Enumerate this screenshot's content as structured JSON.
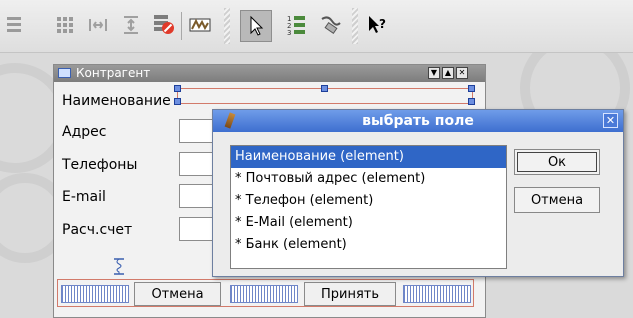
{
  "toolbar": {
    "icons": [
      "distribute-vertical-icon",
      "grid-layout-icon",
      "break-layout-icon",
      "adjust-size-icon",
      "delete-widget-icon",
      "edit-widgets-icon",
      "pointer-icon",
      "tab-order-icon",
      "edit-connections-icon",
      "whats-this-icon"
    ],
    "active": "pointer-icon"
  },
  "form": {
    "title": "Контрагент",
    "title_buttons": [
      "▼",
      "▲",
      "✕"
    ],
    "fields": [
      {
        "label": "Наименование"
      },
      {
        "label": "Адрес"
      },
      {
        "label": "Телефоны"
      },
      {
        "label": "E-mail"
      },
      {
        "label": "Расч.счет"
      }
    ],
    "buttons": {
      "cancel": "Отмена",
      "accept": "Принять"
    }
  },
  "dialog": {
    "title": "выбрать поле",
    "close": "✕",
    "items": [
      "Наименование (element)",
      "* Почтовый адрес (element)",
      "* Телефон (element)",
      "* E-Mail (element)",
      "* Банк (element)"
    ],
    "selected_index": 0,
    "ok": "Ок",
    "cancel": "Отмена"
  },
  "colors": {
    "selection": "#2f66c6",
    "title_bar": "#3e6fcf",
    "layout_frame": "#d27a6a"
  }
}
